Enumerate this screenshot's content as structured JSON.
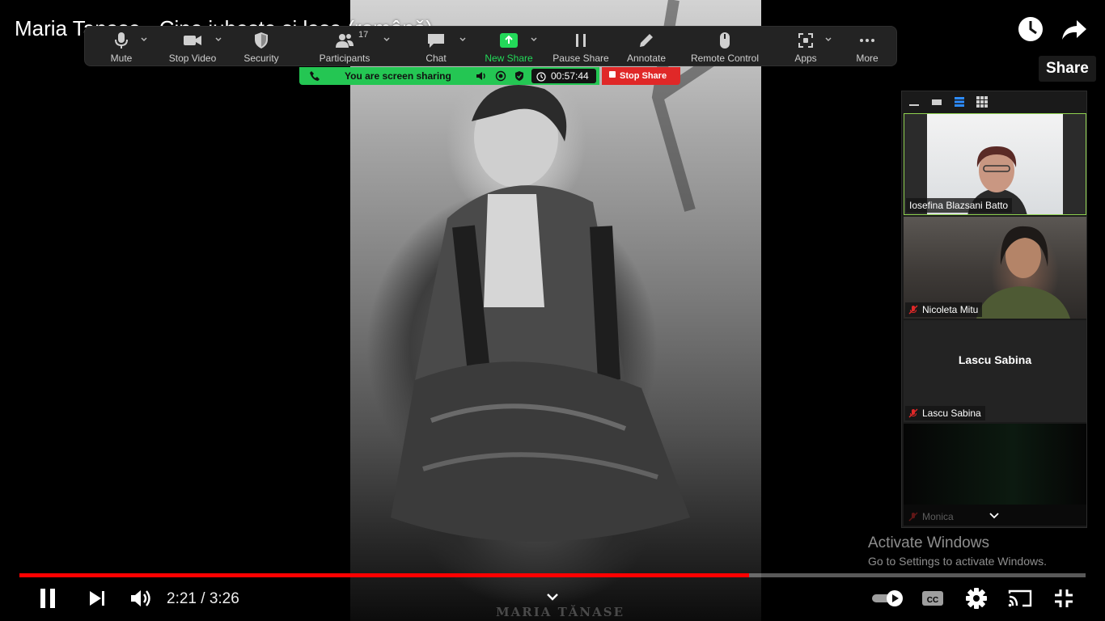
{
  "video": {
    "title": "Maria Tanase - Cine iubeste si lasa (românǎ)",
    "photo_caption": "MARIA TĂNASE",
    "share_tooltip": "Share",
    "current_time": "2:21",
    "duration": "3:26",
    "time_display": "2:21 / 3:26",
    "progress_fraction": 0.6845
  },
  "zoom_toolbar": {
    "buttons": [
      {
        "id": "mute",
        "label": "Mute",
        "icon": "microphone-icon"
      },
      {
        "id": "stop-video",
        "label": "Stop Video",
        "icon": "video-camera-icon"
      },
      {
        "id": "security",
        "label": "Security",
        "icon": "shield-icon"
      },
      {
        "id": "participants",
        "label": "Participants",
        "icon": "participants-icon",
        "count": "17"
      },
      {
        "id": "chat",
        "label": "Chat",
        "icon": "chat-bubble-icon"
      },
      {
        "id": "new-share",
        "label": "New Share",
        "icon": "share-screen-icon"
      },
      {
        "id": "pause-share",
        "label": "Pause Share",
        "icon": "pause-icon"
      },
      {
        "id": "annotate",
        "label": "Annotate",
        "icon": "pencil-icon"
      },
      {
        "id": "remote-control",
        "label": "Remote Control",
        "icon": "mouse-icon"
      },
      {
        "id": "apps",
        "label": "Apps",
        "icon": "apps-icon"
      },
      {
        "id": "more",
        "label": "More",
        "icon": "ellipsis-icon"
      }
    ]
  },
  "share_bar": {
    "status": "You are screen sharing",
    "timer": "00:57:44",
    "stop_label": "Stop Share"
  },
  "gallery": {
    "participants": [
      {
        "name": "Iosefina Blazsani Batto",
        "muted": false,
        "video": true
      },
      {
        "name": "Nicoleta Mitu",
        "muted": true,
        "video": true
      },
      {
        "name": "Lascu Sabina",
        "muted": true,
        "video": false,
        "center_name": "Lascu Sabina"
      },
      {
        "name": "Monica",
        "muted": true,
        "video": true
      }
    ]
  },
  "watermark": {
    "title": "Activate Windows",
    "subtitle": "Go to Settings to activate Windows."
  },
  "colors": {
    "zoom_green": "#23d959",
    "stop_red": "#e02828",
    "progress_red": "#ff0000"
  }
}
